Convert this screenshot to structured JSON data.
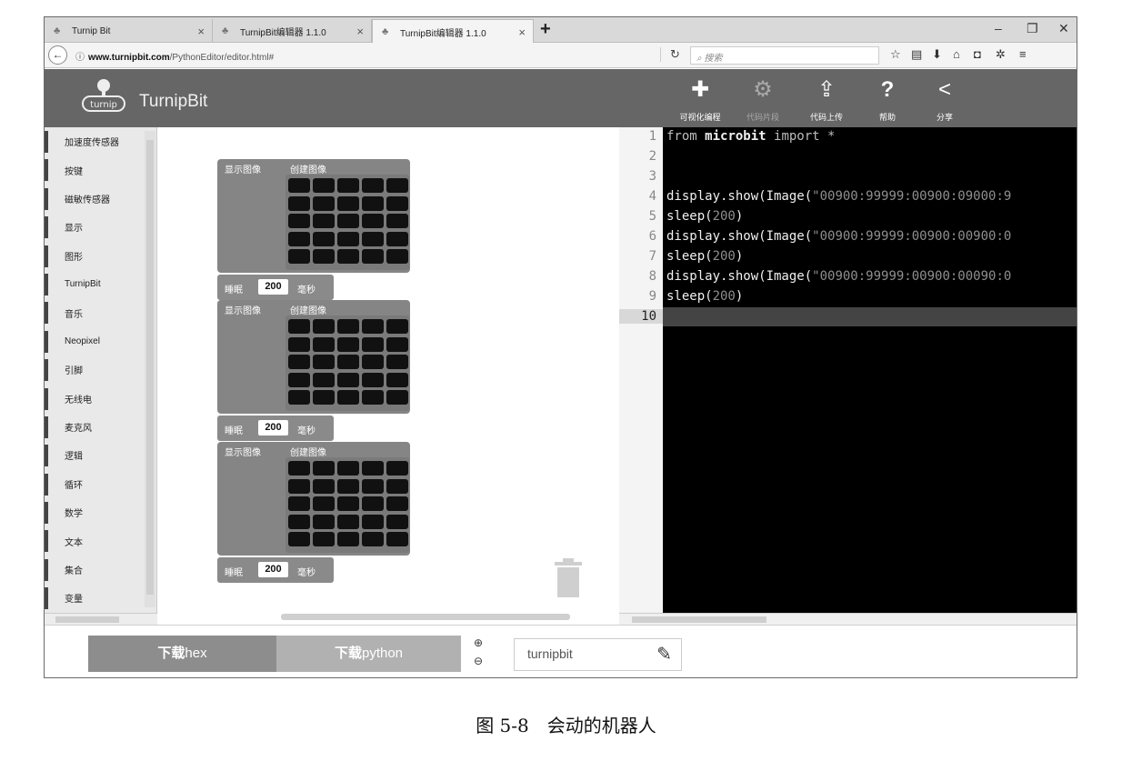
{
  "browser": {
    "tabs": [
      {
        "label": "Turnip Bit",
        "active": false
      },
      {
        "label": "TurnipBit编辑器 1.1.0",
        "active": false
      },
      {
        "label": "TurnipBit编辑器 1.1.0",
        "active": true
      }
    ],
    "url_host": "www.turnipbit.com",
    "url_path": "/PythonEditor/editor.html#",
    "search_placeholder": "搜索"
  },
  "app": {
    "brand": "TurnipBit",
    "logo_text": "turnip",
    "header_buttons": [
      {
        "label": "可视化编程",
        "icon": "puzzle-icon",
        "enabled": true
      },
      {
        "label": "代码片段",
        "icon": "gears-icon",
        "enabled": false
      },
      {
        "label": "代码上传",
        "icon": "upload-icon",
        "enabled": true
      },
      {
        "label": "帮助",
        "icon": "question-icon",
        "enabled": true
      },
      {
        "label": "分享",
        "icon": "share-icon",
        "enabled": true
      }
    ]
  },
  "sidebar": {
    "categories": [
      "加速度传感器",
      "按键",
      "磁敏传感器",
      "显示",
      "图形",
      "TurnipBit",
      "音乐",
      "Neopixel",
      "引脚",
      "无线电",
      "麦克风",
      "逻辑",
      "循环",
      "数学",
      "文本",
      "集合",
      "变量"
    ]
  },
  "workspace": {
    "blocks": [
      {
        "show_label": "显示图像",
        "create_label": "创建图像",
        "sleep_label": "睡眠",
        "sleep_value": "200",
        "sleep_unit": "毫秒"
      },
      {
        "show_label": "显示图像",
        "create_label": "创建图像",
        "sleep_label": "睡眠",
        "sleep_value": "200",
        "sleep_unit": "毫秒"
      },
      {
        "show_label": "显示图像",
        "create_label": "创建图像",
        "sleep_label": "睡眠",
        "sleep_value": "200",
        "sleep_unit": "毫秒"
      }
    ]
  },
  "editor": {
    "line_numbers": [
      "1",
      "2",
      "3",
      "4",
      "5",
      "6",
      "7",
      "8",
      "9",
      "10"
    ],
    "current_line": 10,
    "lines": [
      {
        "tokens": [
          {
            "t": "from ",
            "c": "kw"
          },
          {
            "t": "microbit",
            "c": "b"
          },
          {
            "t": " import *",
            "c": "kw"
          }
        ]
      },
      {
        "tokens": []
      },
      {
        "tokens": []
      },
      {
        "tokens": [
          {
            "t": "display.show(Image(",
            "c": ""
          },
          {
            "t": "\"00900:99999:00900:09000:9",
            "c": "str"
          }
        ]
      },
      {
        "tokens": [
          {
            "t": "sleep(",
            "c": ""
          },
          {
            "t": "200",
            "c": "num"
          },
          {
            "t": ")",
            "c": ""
          }
        ]
      },
      {
        "tokens": [
          {
            "t": "display.show(Image(",
            "c": ""
          },
          {
            "t": "\"00900:99999:00900:00900:0",
            "c": "str"
          }
        ]
      },
      {
        "tokens": [
          {
            "t": "sleep(",
            "c": ""
          },
          {
            "t": "200",
            "c": "num"
          },
          {
            "t": ")",
            "c": ""
          }
        ]
      },
      {
        "tokens": [
          {
            "t": "display.show(Image(",
            "c": ""
          },
          {
            "t": "\"00900:99999:00900:00090:0",
            "c": "str"
          }
        ]
      },
      {
        "tokens": [
          {
            "t": "sleep(",
            "c": ""
          },
          {
            "t": "200",
            "c": "num"
          },
          {
            "t": ")",
            "c": ""
          }
        ]
      },
      {
        "tokens": []
      }
    ]
  },
  "bottom": {
    "download_hex_bold": "下载",
    "download_hex": "hex",
    "download_python_bold": "下载",
    "download_python": "python",
    "project_name": "turnipbit"
  },
  "caption": "图 5-8　会动的机器人"
}
